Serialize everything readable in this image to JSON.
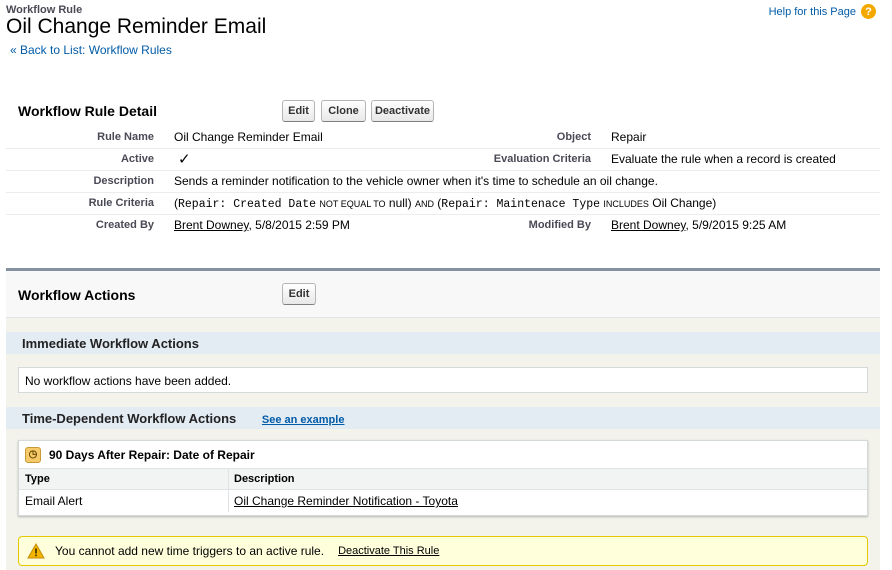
{
  "header": {
    "breadcrumb": "Workflow Rule",
    "title": "Oil Change Reminder Email",
    "back_link": "« Back to List: Workflow Rules",
    "help_label": "Help for this Page",
    "help_icon": "?"
  },
  "detail": {
    "section_title": "Workflow Rule Detail",
    "buttons": {
      "edit": "Edit",
      "clone": "Clone",
      "deactivate": "Deactivate"
    },
    "rule_name_label": "Rule Name",
    "rule_name": "Oil Change Reminder Email",
    "object_label": "Object",
    "object": "Repair",
    "active_label": "Active",
    "active_check": "✓",
    "eval_label": "Evaluation Criteria",
    "eval_value": "Evaluate the rule when a record is created",
    "description_label": "Description",
    "description": "Sends a reminder notification to the vehicle owner when it's time to schedule an oil change.",
    "criteria_label": "Rule Criteria",
    "criteria": {
      "open": "(",
      "field1": "Repair: Created Date",
      "op1": "NOT EQUAL TO",
      "val1": "null)",
      "and": "AND",
      "open2": "(",
      "field2": "Repair: Maintenace Type",
      "op2": "INCLUDES",
      "val2": "Oil Change)"
    },
    "created_by_label": "Created By",
    "created_by_user": "Brent Downey",
    "created_by_date": ", 5/8/2015 2:59 PM",
    "modified_by_label": "Modified By",
    "modified_by_user": "Brent Downey",
    "modified_by_date": ", 5/9/2015 9:25 AM"
  },
  "actions": {
    "section_title": "Workflow Actions",
    "edit_button": "Edit",
    "immediate_title": "Immediate Workflow Actions",
    "immediate_empty": "No workflow actions have been added.",
    "time_dependent_title": "Time-Dependent Workflow Actions",
    "see_example": "See an example",
    "trigger_title": "90 Days After Repair: Date of Repair",
    "columns": {
      "type": "Type",
      "description": "Description"
    },
    "rows": [
      {
        "type": "Email Alert",
        "description": "Oil Change Reminder Notification - Toyota"
      }
    ],
    "warning_text": "You cannot add new time triggers to an active rule.",
    "warning_link": "Deactivate This Rule"
  },
  "colors": {
    "panel_border": "#8792a0",
    "subheader_bg": "#e3ebf3",
    "link": "#015ba7",
    "warning_bg": "#ffffdc",
    "warning_border": "#e4c900"
  }
}
